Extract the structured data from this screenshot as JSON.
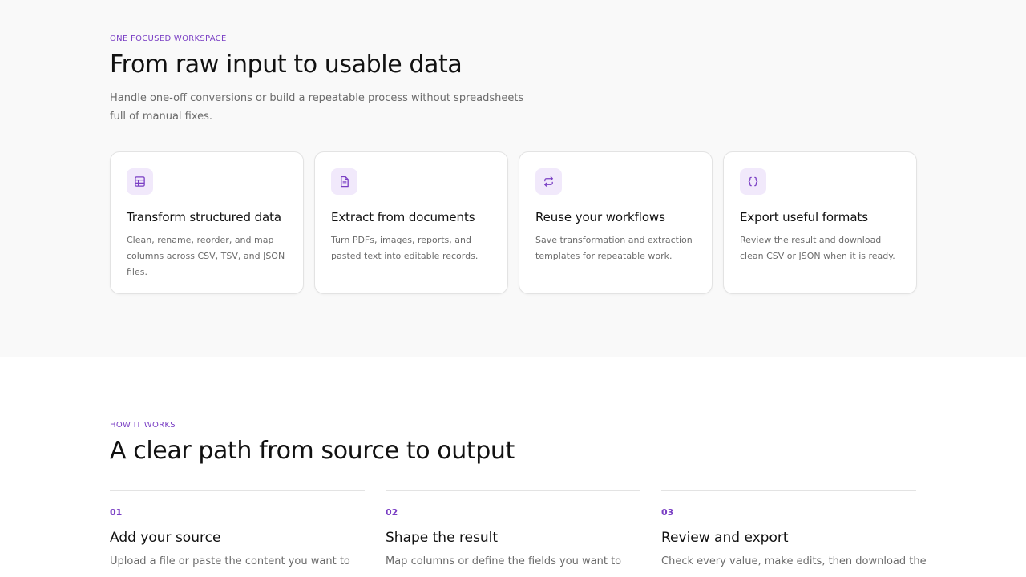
{
  "features": {
    "eyebrow": "ONE FOCUSED WORKSPACE",
    "title": "From raw input to usable data",
    "lead": "Handle one-off conversions or build a repeatable process without spreadsheets full of manual fixes.",
    "cards": [
      {
        "icon": "table-icon",
        "title": "Transform structured data",
        "desc": "Clean, rename, reorder, and map columns across CSV, TSV, and JSON files."
      },
      {
        "icon": "document-icon",
        "title": "Extract from documents",
        "desc": "Turn PDFs, images, reports, and pasted text into editable records."
      },
      {
        "icon": "repeat-icon",
        "title": "Reuse your workflows",
        "desc": "Save transformation and extraction templates for repeatable work."
      },
      {
        "icon": "braces-icon",
        "title": "Export useful formats",
        "desc": "Review the result and download clean CSV or JSON when it is ready."
      }
    ]
  },
  "how": {
    "eyebrow": "HOW IT WORKS",
    "title": "A clear path from source to output",
    "steps": [
      {
        "num": "01",
        "title": "Add your source",
        "desc": "Upload a file or paste the content you want to"
      },
      {
        "num": "02",
        "title": "Shape the result",
        "desc": "Map columns or define the fields you want to"
      },
      {
        "num": "03",
        "title": "Review and export",
        "desc": "Check every value, make edits, then download the"
      }
    ]
  },
  "colors": {
    "accent": "#7a3fc4",
    "icon_bg": "#f1e9fb",
    "muted_text": "#6b6b6b"
  }
}
